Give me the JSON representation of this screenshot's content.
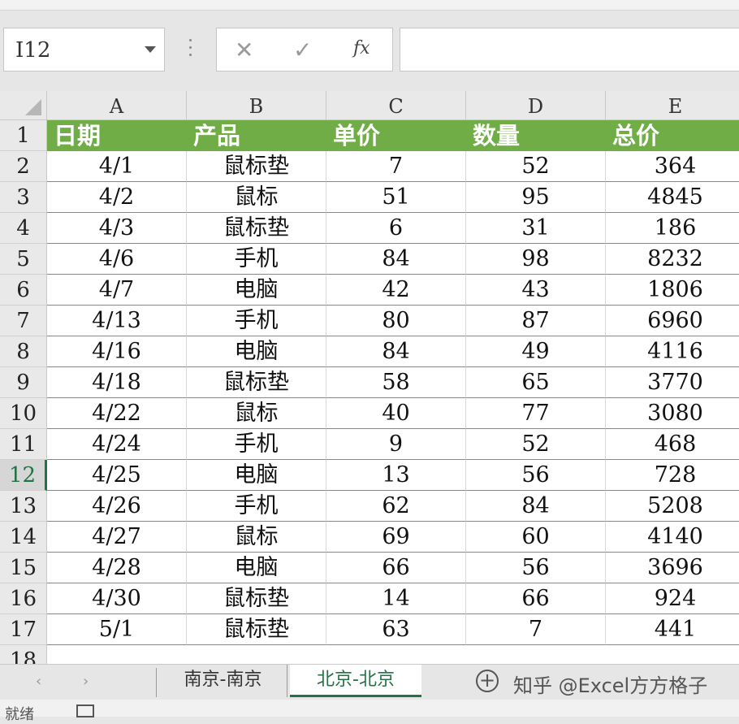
{
  "namebox": {
    "value": "I12"
  },
  "formula": {
    "cancel_icon": "✕",
    "enter_icon": "✓",
    "function_label": "fx",
    "content": ""
  },
  "columns": [
    "A",
    "B",
    "C",
    "D",
    "E"
  ],
  "rows": [
    "1",
    "2",
    "3",
    "4",
    "5",
    "6",
    "7",
    "8",
    "9",
    "10",
    "11",
    "12",
    "13",
    "14",
    "15",
    "16",
    "17",
    "18"
  ],
  "active_row": "12",
  "table": {
    "headers": [
      "日期",
      "产品",
      "单价",
      "数量",
      "总价"
    ],
    "body": [
      [
        "4/1",
        "鼠标垫",
        "7",
        "52",
        "364"
      ],
      [
        "4/2",
        "鼠标",
        "51",
        "95",
        "4845"
      ],
      [
        "4/3",
        "鼠标垫",
        "6",
        "31",
        "186"
      ],
      [
        "4/6",
        "手机",
        "84",
        "98",
        "8232"
      ],
      [
        "4/7",
        "电脑",
        "42",
        "43",
        "1806"
      ],
      [
        "4/13",
        "手机",
        "80",
        "87",
        "6960"
      ],
      [
        "4/16",
        "电脑",
        "84",
        "49",
        "4116"
      ],
      [
        "4/18",
        "鼠标垫",
        "58",
        "65",
        "3770"
      ],
      [
        "4/22",
        "鼠标",
        "40",
        "77",
        "3080"
      ],
      [
        "4/24",
        "手机",
        "9",
        "52",
        "468"
      ],
      [
        "4/25",
        "电脑",
        "13",
        "56",
        "728"
      ],
      [
        "4/26",
        "手机",
        "62",
        "84",
        "5208"
      ],
      [
        "4/27",
        "鼠标",
        "69",
        "60",
        "4140"
      ],
      [
        "4/28",
        "电脑",
        "66",
        "56",
        "3696"
      ],
      [
        "4/30",
        "鼠标垫",
        "14",
        "66",
        "924"
      ],
      [
        "5/1",
        "鼠标垫",
        "63",
        "7",
        "441"
      ]
    ]
  },
  "sheet_tabs": [
    {
      "label": "南京-南京",
      "active": false
    },
    {
      "label": "北京-北京",
      "active": true
    }
  ],
  "nav": {
    "prev": "‹",
    "next": "›"
  },
  "add_sheet_icon": "+",
  "watermark": "知乎 @Excel方方格子",
  "status": {
    "text": "就绪"
  },
  "colors": {
    "header_fill": "#70ad47",
    "accent": "#217346",
    "row_border": "#6ba43a"
  }
}
